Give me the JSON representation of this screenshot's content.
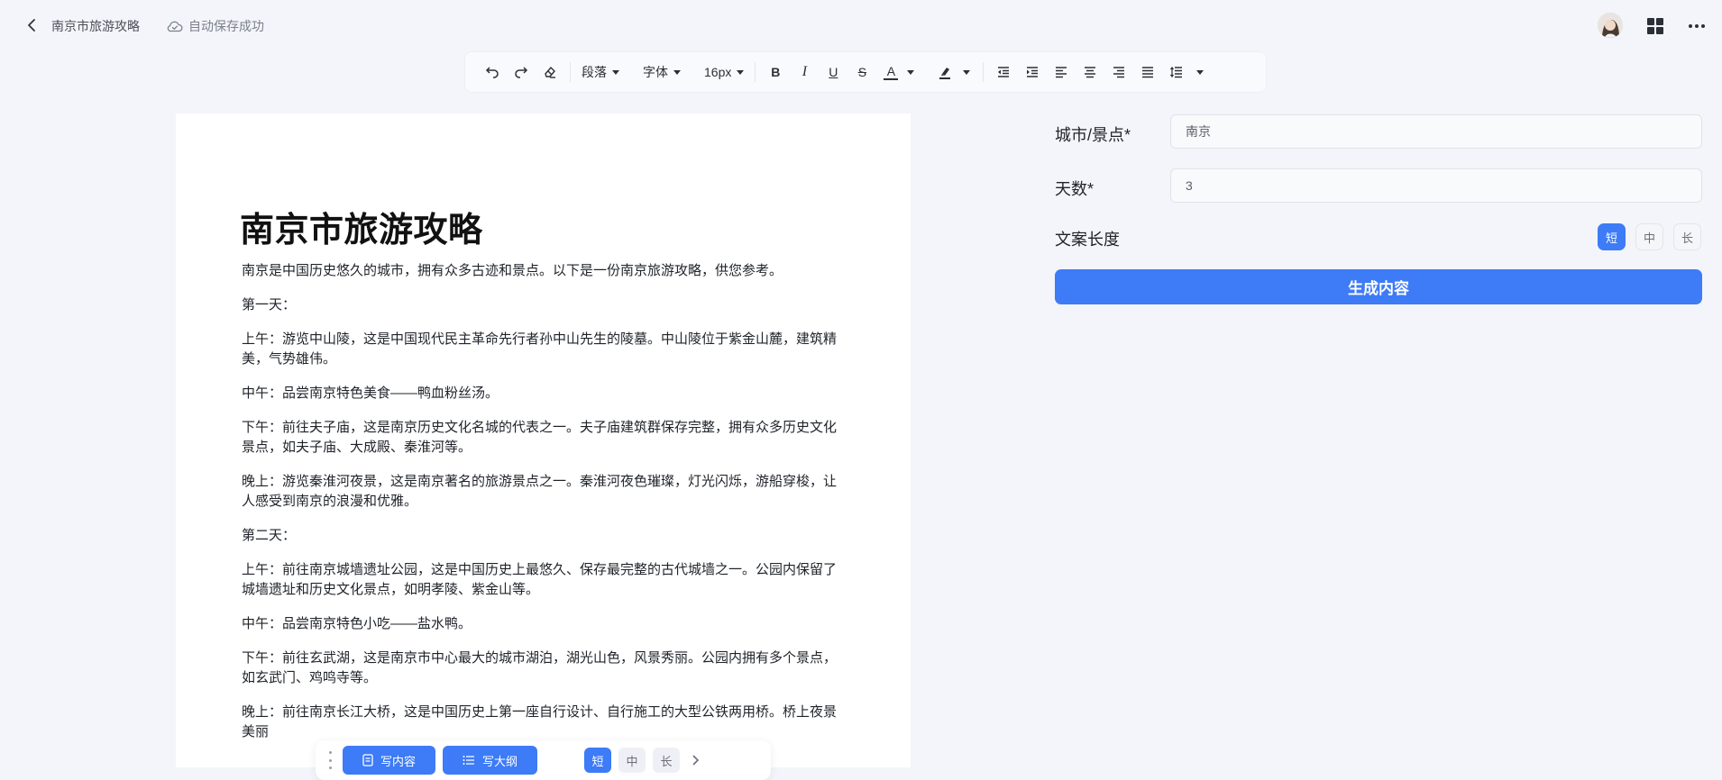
{
  "header": {
    "doc_title": "南京市旅游攻略",
    "save_status": "自动保存成功"
  },
  "toolbar": {
    "paragraph": "段落",
    "font": "字体",
    "font_size": "16px",
    "bold": "B",
    "italic": "I",
    "underline": "U",
    "strike": "S",
    "font_color": "A"
  },
  "document": {
    "title": "南京市旅游攻略",
    "paragraphs": [
      "南京是中国历史悠久的城市，拥有众多古迹和景点。以下是一份南京旅游攻略，供您参考。",
      "第一天：",
      "上午：游览中山陵，这是中国现代民主革命先行者孙中山先生的陵墓。中山陵位于紫金山麓，建筑精美，气势雄伟。",
      "中午：品尝南京特色美食——鸭血粉丝汤。",
      "下午：前往夫子庙，这是南京历史文化名城的代表之一。夫子庙建筑群保存完整，拥有众多历史文化景点，如夫子庙、大成殿、秦淮河等。",
      "晚上：游览秦淮河夜景，这是南京著名的旅游景点之一。秦淮河夜色璀璨，灯光闪烁，游船穿梭，让人感受到南京的浪漫和优雅。",
      "第二天：",
      "上午：前往南京城墙遗址公园，这是中国历史上最悠久、保存最完整的古代城墙之一。公园内保留了城墙遗址和历史文化景点，如明孝陵、紫金山等。",
      "中午：品尝南京特色小吃——盐水鸭。",
      "下午：前往玄武湖，这是南京市中心最大的城市湖泊，湖光山色，风景秀丽。公园内拥有多个景点，如玄武门、鸡鸣寺等。",
      "晚上：前往南京长江大桥，这是中国历史上第一座自行设计、自行施工的大型公铁两用桥。桥上夜景美丽"
    ]
  },
  "bottombar": {
    "write_content": "写内容",
    "write_outline": "写大纲",
    "len_short": "短",
    "len_medium": "中",
    "len_long": "长"
  },
  "panel": {
    "city_label": "城市/景点*",
    "city_value": "南京",
    "days_label": "天数*",
    "days_value": "3",
    "length_label": "文案长度",
    "len_short": "短",
    "len_medium": "中",
    "len_long": "长",
    "generate": "生成内容"
  },
  "colors": {
    "accent": "#3d7bf7",
    "background": "#f3f5fa"
  }
}
